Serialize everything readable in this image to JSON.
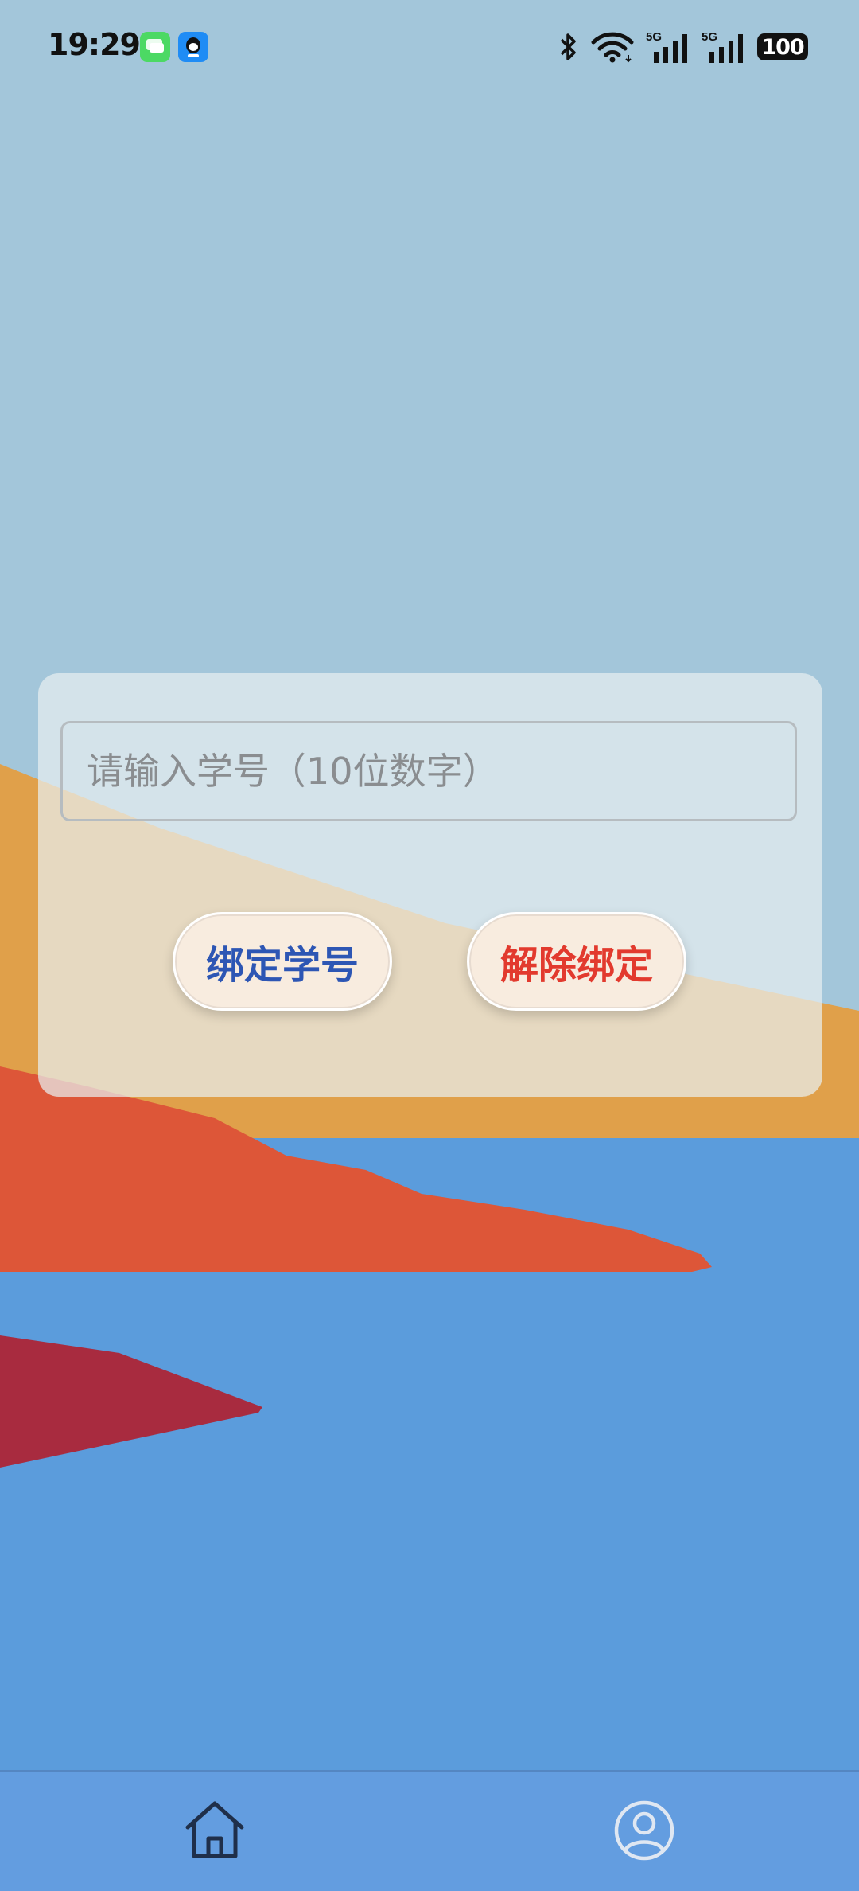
{
  "status_bar": {
    "time": "19:29",
    "network_1": "5G",
    "network_2": "5G",
    "battery": "100"
  },
  "form": {
    "student_id_placeholder": "请输入学号（10位数字）",
    "student_id_value": "",
    "bind_label": "绑定学号",
    "unbind_label": "解除绑定"
  },
  "bottom_nav": {
    "items": [
      {
        "icon": "home-icon"
      },
      {
        "icon": "profile-icon"
      }
    ]
  },
  "colors": {
    "sky": "#a3c6da",
    "sand": "#e0a04a",
    "red_hill": "#dd5638",
    "crimson": "#a82b3f",
    "water": "#5b9cdc",
    "nav": "#639de0",
    "bind_text": "#2d56b4",
    "unbind_text": "#e23a2e"
  }
}
